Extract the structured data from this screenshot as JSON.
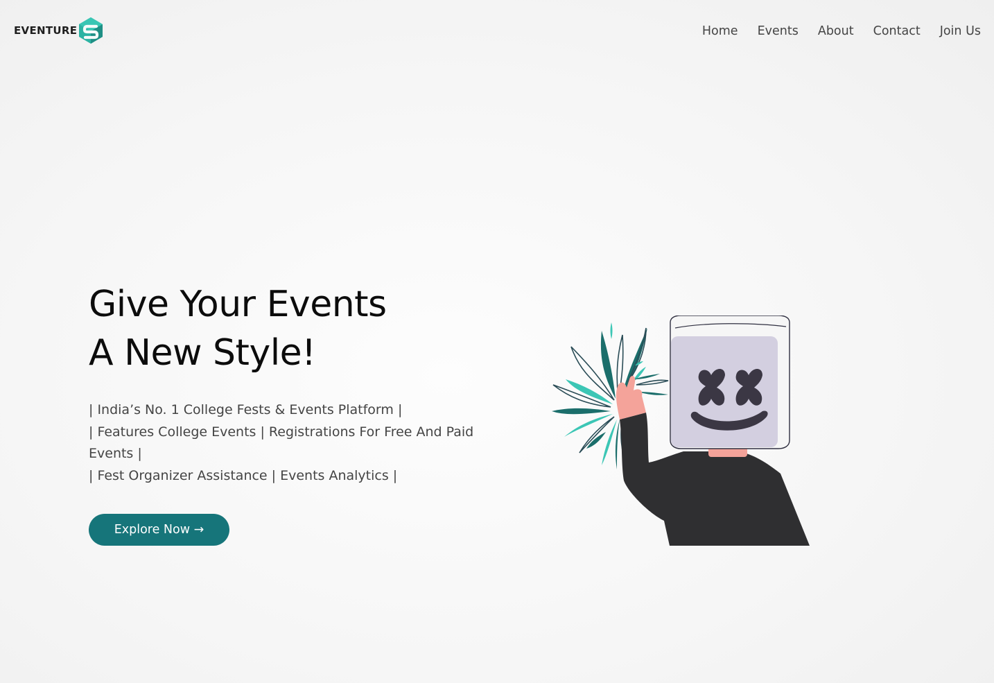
{
  "brand": {
    "name": "EVENTURE",
    "accent": "#2ba89f"
  },
  "nav": {
    "items": [
      {
        "label": "Home"
      },
      {
        "label": "Events"
      },
      {
        "label": "About"
      },
      {
        "label": "Contact"
      },
      {
        "label": "Join Us"
      }
    ]
  },
  "hero": {
    "title_line1": "Give Your Events",
    "title_line2": "A New Style!",
    "description_lines": [
      "| India’s No. 1 College Fests & Events Platform |",
      "| Features College Events | Registrations For Free And Paid Events |",
      "| Fest Organizer Assistance | Events Analytics |"
    ],
    "cta_label": "Explore Now →"
  },
  "colors": {
    "button_bg": "#16757a",
    "title_text": "#0c0c0c",
    "body_text": "#444444",
    "illustration_mask": "#d3cfe0",
    "illustration_sweater": "#2f2f31",
    "illustration_burst_dark": "#1b6e6b",
    "illustration_burst_light": "#3cc6b5"
  },
  "icons": {
    "logo": "eventure-s-logo-icon",
    "illustration": "marshmello-firework-illustration"
  }
}
